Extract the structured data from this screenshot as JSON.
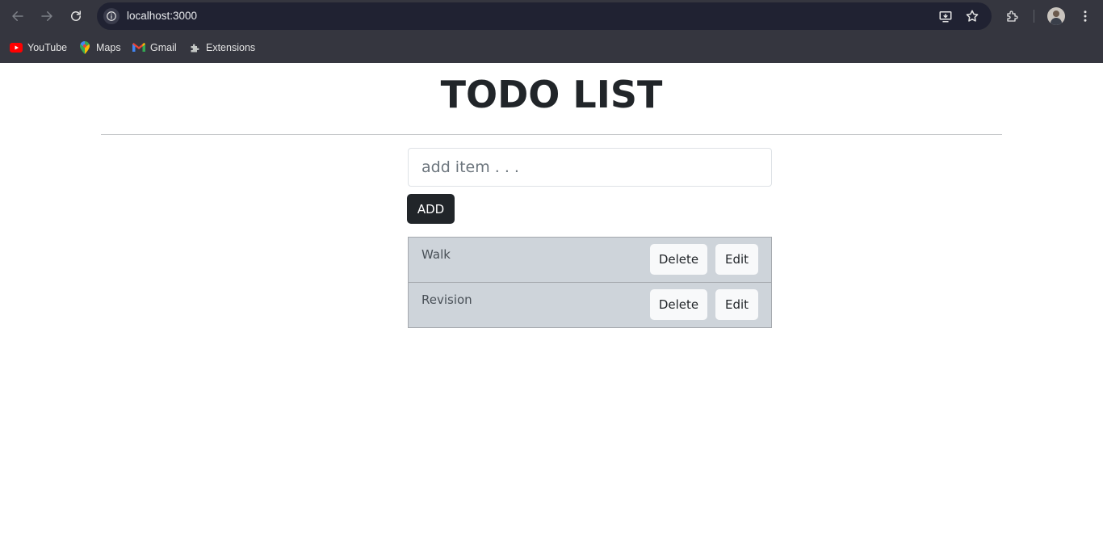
{
  "browser": {
    "url": "localhost:3000",
    "bookmarks": [
      {
        "label": "YouTube",
        "icon": "youtube-icon"
      },
      {
        "label": "Maps",
        "icon": "maps-icon"
      },
      {
        "label": "Gmail",
        "icon": "gmail-icon"
      },
      {
        "label": "Extensions",
        "icon": "puzzle-icon"
      }
    ],
    "colors": {
      "chrome_bg": "#35363f",
      "omnibox_bg": "#202232"
    }
  },
  "page": {
    "title": "TODO LIST",
    "input": {
      "placeholder": "add item . . .",
      "value": ""
    },
    "add_label": "ADD",
    "items": [
      {
        "text": "Walk",
        "delete_label": "Delete",
        "edit_label": "Edit"
      },
      {
        "text": "Revision",
        "delete_label": "Delete",
        "edit_label": "Edit"
      }
    ],
    "colors": {
      "title": "#212529",
      "item_bg": "#ced4da",
      "add_bg": "#212529"
    }
  }
}
